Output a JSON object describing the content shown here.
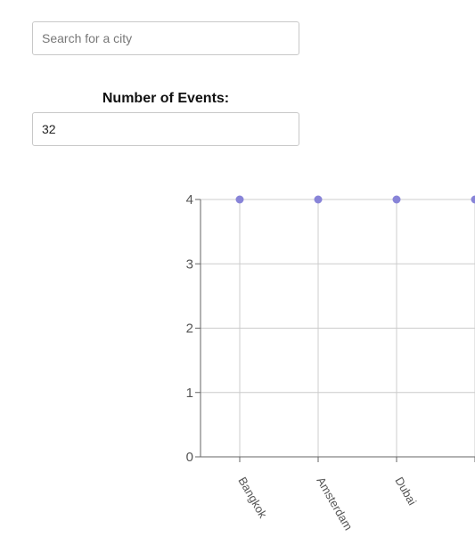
{
  "search": {
    "placeholder": "Search for a city",
    "value": ""
  },
  "events": {
    "label": "Number of Events:",
    "value": "32"
  },
  "colors": {
    "point": "#8884d8",
    "grid": "#cccccc",
    "axis": "#666666"
  },
  "chart_data": {
    "type": "scatter",
    "categories": [
      "Bangkok",
      "Amsterdam",
      "Dubai",
      ""
    ],
    "values": [
      4,
      4,
      4,
      4
    ],
    "y_ticks": [
      0,
      1,
      2,
      3,
      4
    ],
    "ylim": [
      0,
      4
    ],
    "grid": true,
    "title": "",
    "xlabel": "",
    "ylabel": ""
  }
}
